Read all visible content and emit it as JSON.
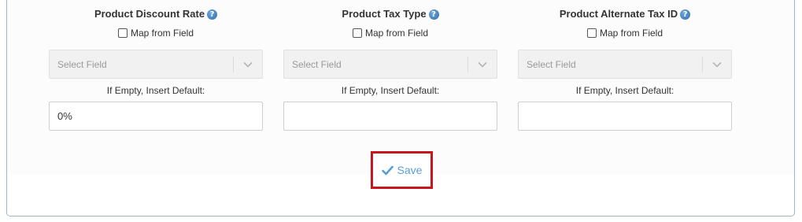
{
  "columns": [
    {
      "title": "Product Discount Rate",
      "help": "?",
      "map_label": "Map from Field",
      "select_placeholder": "Select Field",
      "default_label": "If Empty, Insert Default:",
      "default_value": "0%"
    },
    {
      "title": "Product Tax Type",
      "help": "?",
      "map_label": "Map from Field",
      "select_placeholder": "Select Field",
      "default_label": "If Empty, Insert Default:",
      "default_value": ""
    },
    {
      "title": "Product Alternate Tax ID",
      "help": "?",
      "map_label": "Map from Field",
      "select_placeholder": "Select Field",
      "default_label": "If Empty, Insert Default:",
      "default_value": ""
    }
  ],
  "save": {
    "label": "Save",
    "icon": "check-icon"
  },
  "colors": {
    "accent": "#5a9fd4",
    "highlight_border": "#c8161f",
    "panel_border": "#9fb7c8"
  }
}
